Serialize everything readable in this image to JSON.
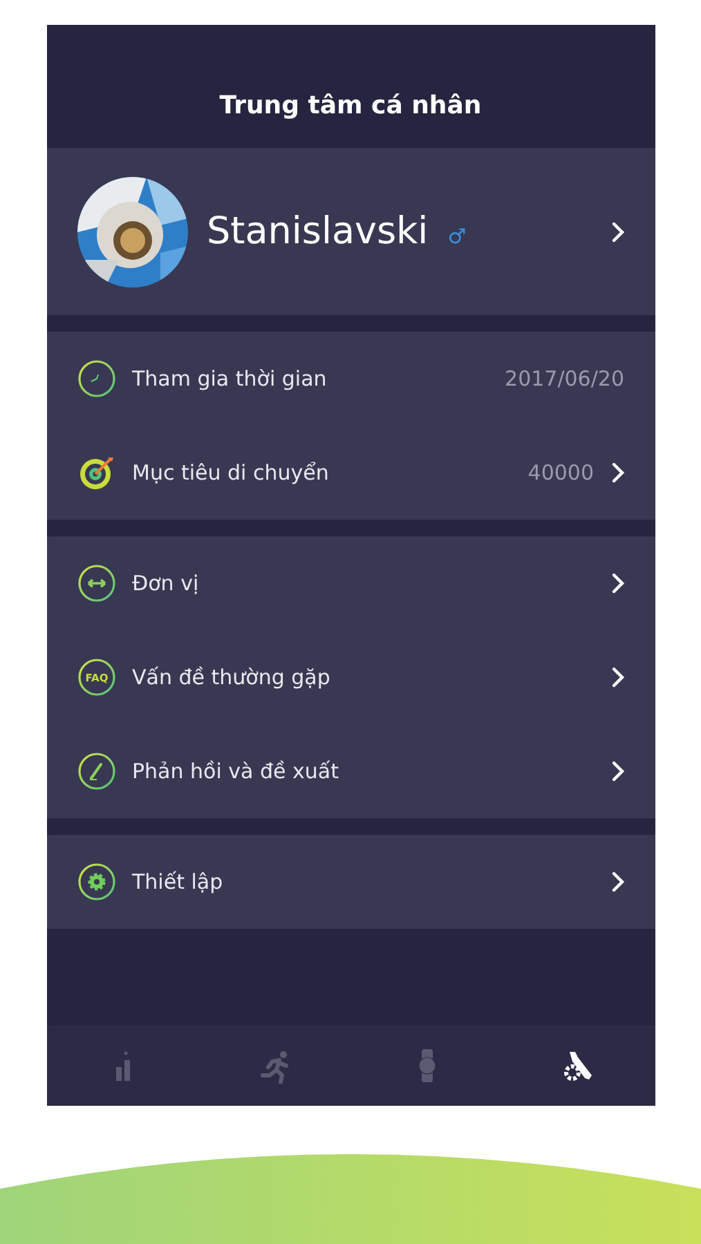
{
  "header": {
    "title": "Trung tâm cá nhân"
  },
  "profile": {
    "name": "Stanislavski",
    "gender_symbol": "♂"
  },
  "sections": [
    {
      "items": [
        {
          "kind": "clock",
          "label": "Tham gia thời gian",
          "value": "2017/06/20",
          "chevron": false
        },
        {
          "kind": "target",
          "label": "Mục tiêu di chuyển",
          "value": "40000",
          "chevron": true
        }
      ]
    },
    {
      "items": [
        {
          "kind": "unit",
          "label": "Đơn vị",
          "chevron": true
        },
        {
          "kind": "faq",
          "icon_label": "FAQ",
          "label": "Vấn đề thường gặp",
          "chevron": true
        },
        {
          "kind": "pen",
          "label": "Phản hồi và đề xuất",
          "chevron": true
        }
      ]
    },
    {
      "items": [
        {
          "kind": "gear",
          "label": "Thiết lập",
          "chevron": true
        }
      ]
    }
  ],
  "tabs": [
    {
      "kind": "stats",
      "selected": false
    },
    {
      "kind": "run",
      "selected": false
    },
    {
      "kind": "watch",
      "selected": false
    },
    {
      "kind": "tools",
      "selected": true
    }
  ]
}
